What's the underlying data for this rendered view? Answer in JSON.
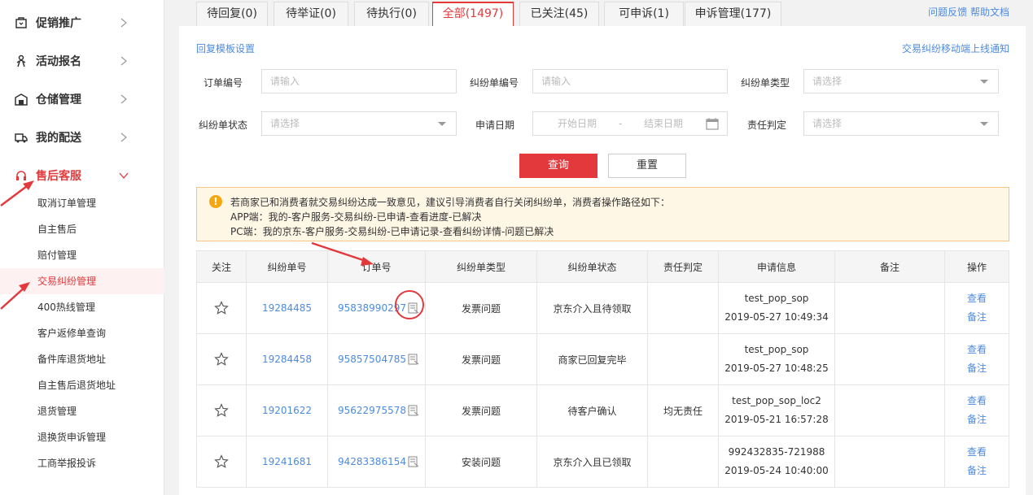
{
  "sidebar": {
    "groups": [
      {
        "label": "促销推广",
        "icon": "promotion-icon"
      },
      {
        "label": "活动报名",
        "icon": "activity-icon"
      },
      {
        "label": "仓储管理",
        "icon": "warehouse-icon"
      },
      {
        "label": "我的配送",
        "icon": "delivery-icon"
      },
      {
        "label": "售后客服",
        "icon": "headset-icon"
      }
    ],
    "items": [
      {
        "label": "取消订单管理"
      },
      {
        "label": "自主售后"
      },
      {
        "label": "赔付管理"
      },
      {
        "label": "交易纠纷管理"
      },
      {
        "label": "400热线管理"
      },
      {
        "label": "客户返修单查询"
      },
      {
        "label": "备件库退货地址"
      },
      {
        "label": "自主售后退货地址"
      },
      {
        "label": "退货管理"
      },
      {
        "label": "退换货申诉管理"
      },
      {
        "label": "工商举报投诉"
      }
    ]
  },
  "tabs": [
    {
      "label": "待回复(0)"
    },
    {
      "label": "待举证(0)"
    },
    {
      "label": "待执行(0)"
    },
    {
      "label": "全部(1497)"
    },
    {
      "label": "已关注(45)"
    },
    {
      "label": "可申诉(1)"
    },
    {
      "label": "申诉管理(177)"
    }
  ],
  "header_links": {
    "feedback": "问题反馈",
    "help": "帮助文档"
  },
  "links": {
    "reply_template": "回复模板设置",
    "mobile_notice": "交易纠纷移动端上线通知"
  },
  "form": {
    "order_no": {
      "label": "订单编号",
      "placeholder": "请输入"
    },
    "dispute_no": {
      "label": "纠纷单编号",
      "placeholder": "请输入"
    },
    "dispute_type": {
      "label": "纠纷单类型",
      "placeholder": "请选择"
    },
    "dispute_status": {
      "label": "纠纷单状态",
      "placeholder": "请选择"
    },
    "apply_date": {
      "label": "申请日期",
      "start": "开始日期",
      "sep": "-",
      "end": "结束日期"
    },
    "responsibility": {
      "label": "责任判定",
      "placeholder": "请选择"
    },
    "query_button": "查询",
    "reset_button": "重置"
  },
  "notice": {
    "icon": "!",
    "line1": "若商家已和消费者就交易纠纷达成一致意见，建议引导消费者自行关闭纠纷单，消费者操作路径如下：",
    "line2": "APP端：我的-客户服务-交易纠纷-已申请-查看进度-已解决",
    "line3": "PC端：我的京东-客户服务-交易纠纷-已申请记录-查看纠纷详情-问题已解决"
  },
  "table": {
    "headers": [
      "关注",
      "纠纷单号",
      "订单号",
      "纠纷单类型",
      "纠纷单状态",
      "责任判定",
      "申请信息",
      "备注",
      "操作"
    ],
    "rows": [
      {
        "dispute_no": "19284485",
        "order_no": "95838990297",
        "type": "发票问题",
        "status": "京东介入且待领取",
        "responsibility": "",
        "applicant": "test_pop_sop",
        "date": "2019-05-27 10:49:34",
        "remark": "",
        "view": "查看",
        "note": "备注"
      },
      {
        "dispute_no": "19284458",
        "order_no": "95857504785",
        "type": "发票问题",
        "status": "商家已回复完毕",
        "responsibility": "",
        "applicant": "test_pop_sop",
        "date": "2019-05-27 10:48:25",
        "remark": "",
        "view": "查看",
        "note": "备注"
      },
      {
        "dispute_no": "19201622",
        "order_no": "95622975578",
        "type": "发票问题",
        "status": "待客户确认",
        "responsibility": "均无责任",
        "applicant": "test_pop_sop_loc2",
        "date": "2019-05-21 16:57:28",
        "remark": "",
        "view": "查看",
        "note": "备注"
      },
      {
        "dispute_no": "19241681",
        "order_no": "94283386154",
        "type": "安装问题",
        "status": "京东介入且已领取",
        "responsibility": "",
        "applicant": "992432835-721988",
        "date": "2019-05-24 10:40:00",
        "remark": "",
        "view": "查看",
        "note": "备注"
      }
    ]
  },
  "colors": {
    "accent": "#e4393c",
    "link": "#4d8bdf",
    "annotation": "#e4393c"
  }
}
